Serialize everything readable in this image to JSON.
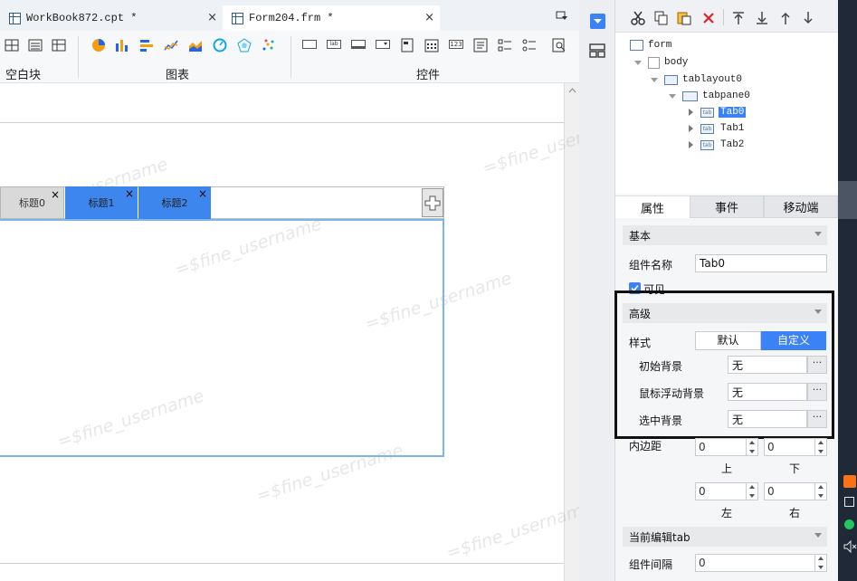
{
  "doc_tabs": [
    {
      "label": "WorkBook872.cpt *",
      "close": "×"
    },
    {
      "label": "Form204.frm *",
      "close": "×"
    }
  ],
  "ribbon": {
    "groups": [
      "空白块",
      "图表",
      "控件"
    ],
    "chart_icons": [
      "pie-chart-icon",
      "bar-chart-icon",
      "horizontal-bar-icon",
      "line-chart-icon",
      "area-chart-icon",
      "gauge-chart-icon",
      "radar-chart-icon",
      "scatter-chart-icon"
    ],
    "control_icons": [
      "textbox-icon",
      "label-icon",
      "button-icon",
      "combobox-icon",
      "frame-icon",
      "date-icon",
      "number-icon",
      "textarea-icon",
      "checkbox-list-icon",
      "radio-list-icon",
      "search-icon"
    ],
    "ctrl_labels": {
      "lab": "lab",
      "num": "123"
    }
  },
  "form_tabs": [
    {
      "label": "标题0",
      "close": "×",
      "active": false
    },
    {
      "label": "标题1",
      "close": "×",
      "active": true
    },
    {
      "label": "标题2",
      "close": "×",
      "active": true
    }
  ],
  "watermark": "=$fine_username",
  "tree": {
    "nodes": [
      {
        "label": "form"
      },
      {
        "label": "body"
      },
      {
        "label": "tablayout0"
      },
      {
        "label": "tabpane0"
      },
      {
        "label": "Tab0",
        "selected": true
      },
      {
        "label": "Tab1"
      },
      {
        "label": "Tab2"
      }
    ],
    "tab_icon_text": "tab"
  },
  "prop_tabs": [
    "属性",
    "事件",
    "移动端"
  ],
  "props": {
    "basic_header": "基本",
    "name_label": "组件名称",
    "name_value": "Tab0",
    "visible_label": "可见",
    "advanced_header": "高级",
    "style_label": "样式",
    "style_default": "默认",
    "style_custom": "自定义",
    "init_bg_label": "初始背景",
    "init_bg_value": "无",
    "hover_bg_label": "鼠标浮动背景",
    "hover_bg_value": "无",
    "selected_bg_label": "选中背景",
    "selected_bg_value": "无",
    "dots": "···",
    "padding_label": "内边距",
    "pad_top": "0",
    "pad_bottom": "0",
    "pad_left": "0",
    "pad_right": "0",
    "top_label": "上",
    "bottom_label": "下",
    "left_label": "左",
    "right_label": "右",
    "cur_tab_header": "当前编辑tab",
    "gap_label": "组件间隔",
    "gap_value": "0"
  },
  "colors": {
    "accent": "#3b82f6",
    "tab_active": "#3d86ee",
    "tab_inactive": "#d9d9d9",
    "highlight_box": "#111111"
  }
}
